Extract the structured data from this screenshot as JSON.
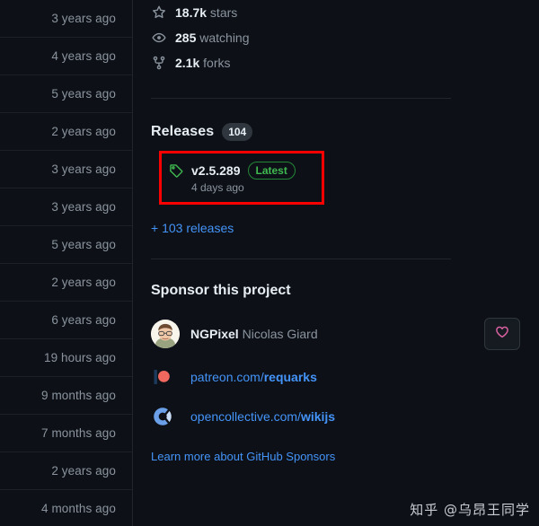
{
  "left_column": {
    "name": "commit-age-list",
    "rows": [
      {
        "age": "3 years ago"
      },
      {
        "age": "4 years ago"
      },
      {
        "age": "5 years ago"
      },
      {
        "age": "2 years ago"
      },
      {
        "age": "3 years ago"
      },
      {
        "age": "3 years ago"
      },
      {
        "age": "5 years ago"
      },
      {
        "age": "2 years ago"
      },
      {
        "age": "6 years ago"
      },
      {
        "age": "19 hours ago"
      },
      {
        "age": "9 months ago"
      },
      {
        "age": "7 months ago"
      },
      {
        "age": "2 years ago"
      },
      {
        "age": "4 months ago"
      }
    ]
  },
  "stats": {
    "items": [
      {
        "icon": "star-icon",
        "value": "18.7k",
        "label": " stars"
      },
      {
        "icon": "eye-icon",
        "value": "285",
        "label": " watching"
      },
      {
        "icon": "fork-icon",
        "value": "2.1k",
        "label": " forks"
      }
    ]
  },
  "releases": {
    "title": "Releases",
    "count": "104",
    "latest": {
      "version": "v2.5.289",
      "badge": "Latest",
      "date": "4 days ago",
      "tag_icon": "tag-icon"
    },
    "more_link": "+ 103 releases",
    "highlight_color": "#ff0000"
  },
  "sponsor": {
    "title": "Sponsor this project",
    "person": {
      "handle": "NGPixel",
      "full_name": "Nicolas Giard",
      "avatar": "user-avatar",
      "sponsor_button_icon": "heart-icon"
    },
    "links": [
      {
        "icon": "patreon-icon",
        "prefix": "patreon.com/",
        "strong": "requarks"
      },
      {
        "icon": "opencollective-icon",
        "prefix": "opencollective.com/",
        "strong": "wikijs"
      }
    ],
    "learn_more": "Learn more about GitHub Sponsors"
  },
  "watermark": {
    "text": "知乎 @乌昂王同学"
  },
  "colors": {
    "background": "#0d1117",
    "text_primary": "#e6edf3",
    "text_muted": "#8b949e",
    "link": "#4493f8",
    "green": "#3fb950",
    "border": "#21262d",
    "highlight": "#ff0000",
    "heart": "#db61a2"
  }
}
